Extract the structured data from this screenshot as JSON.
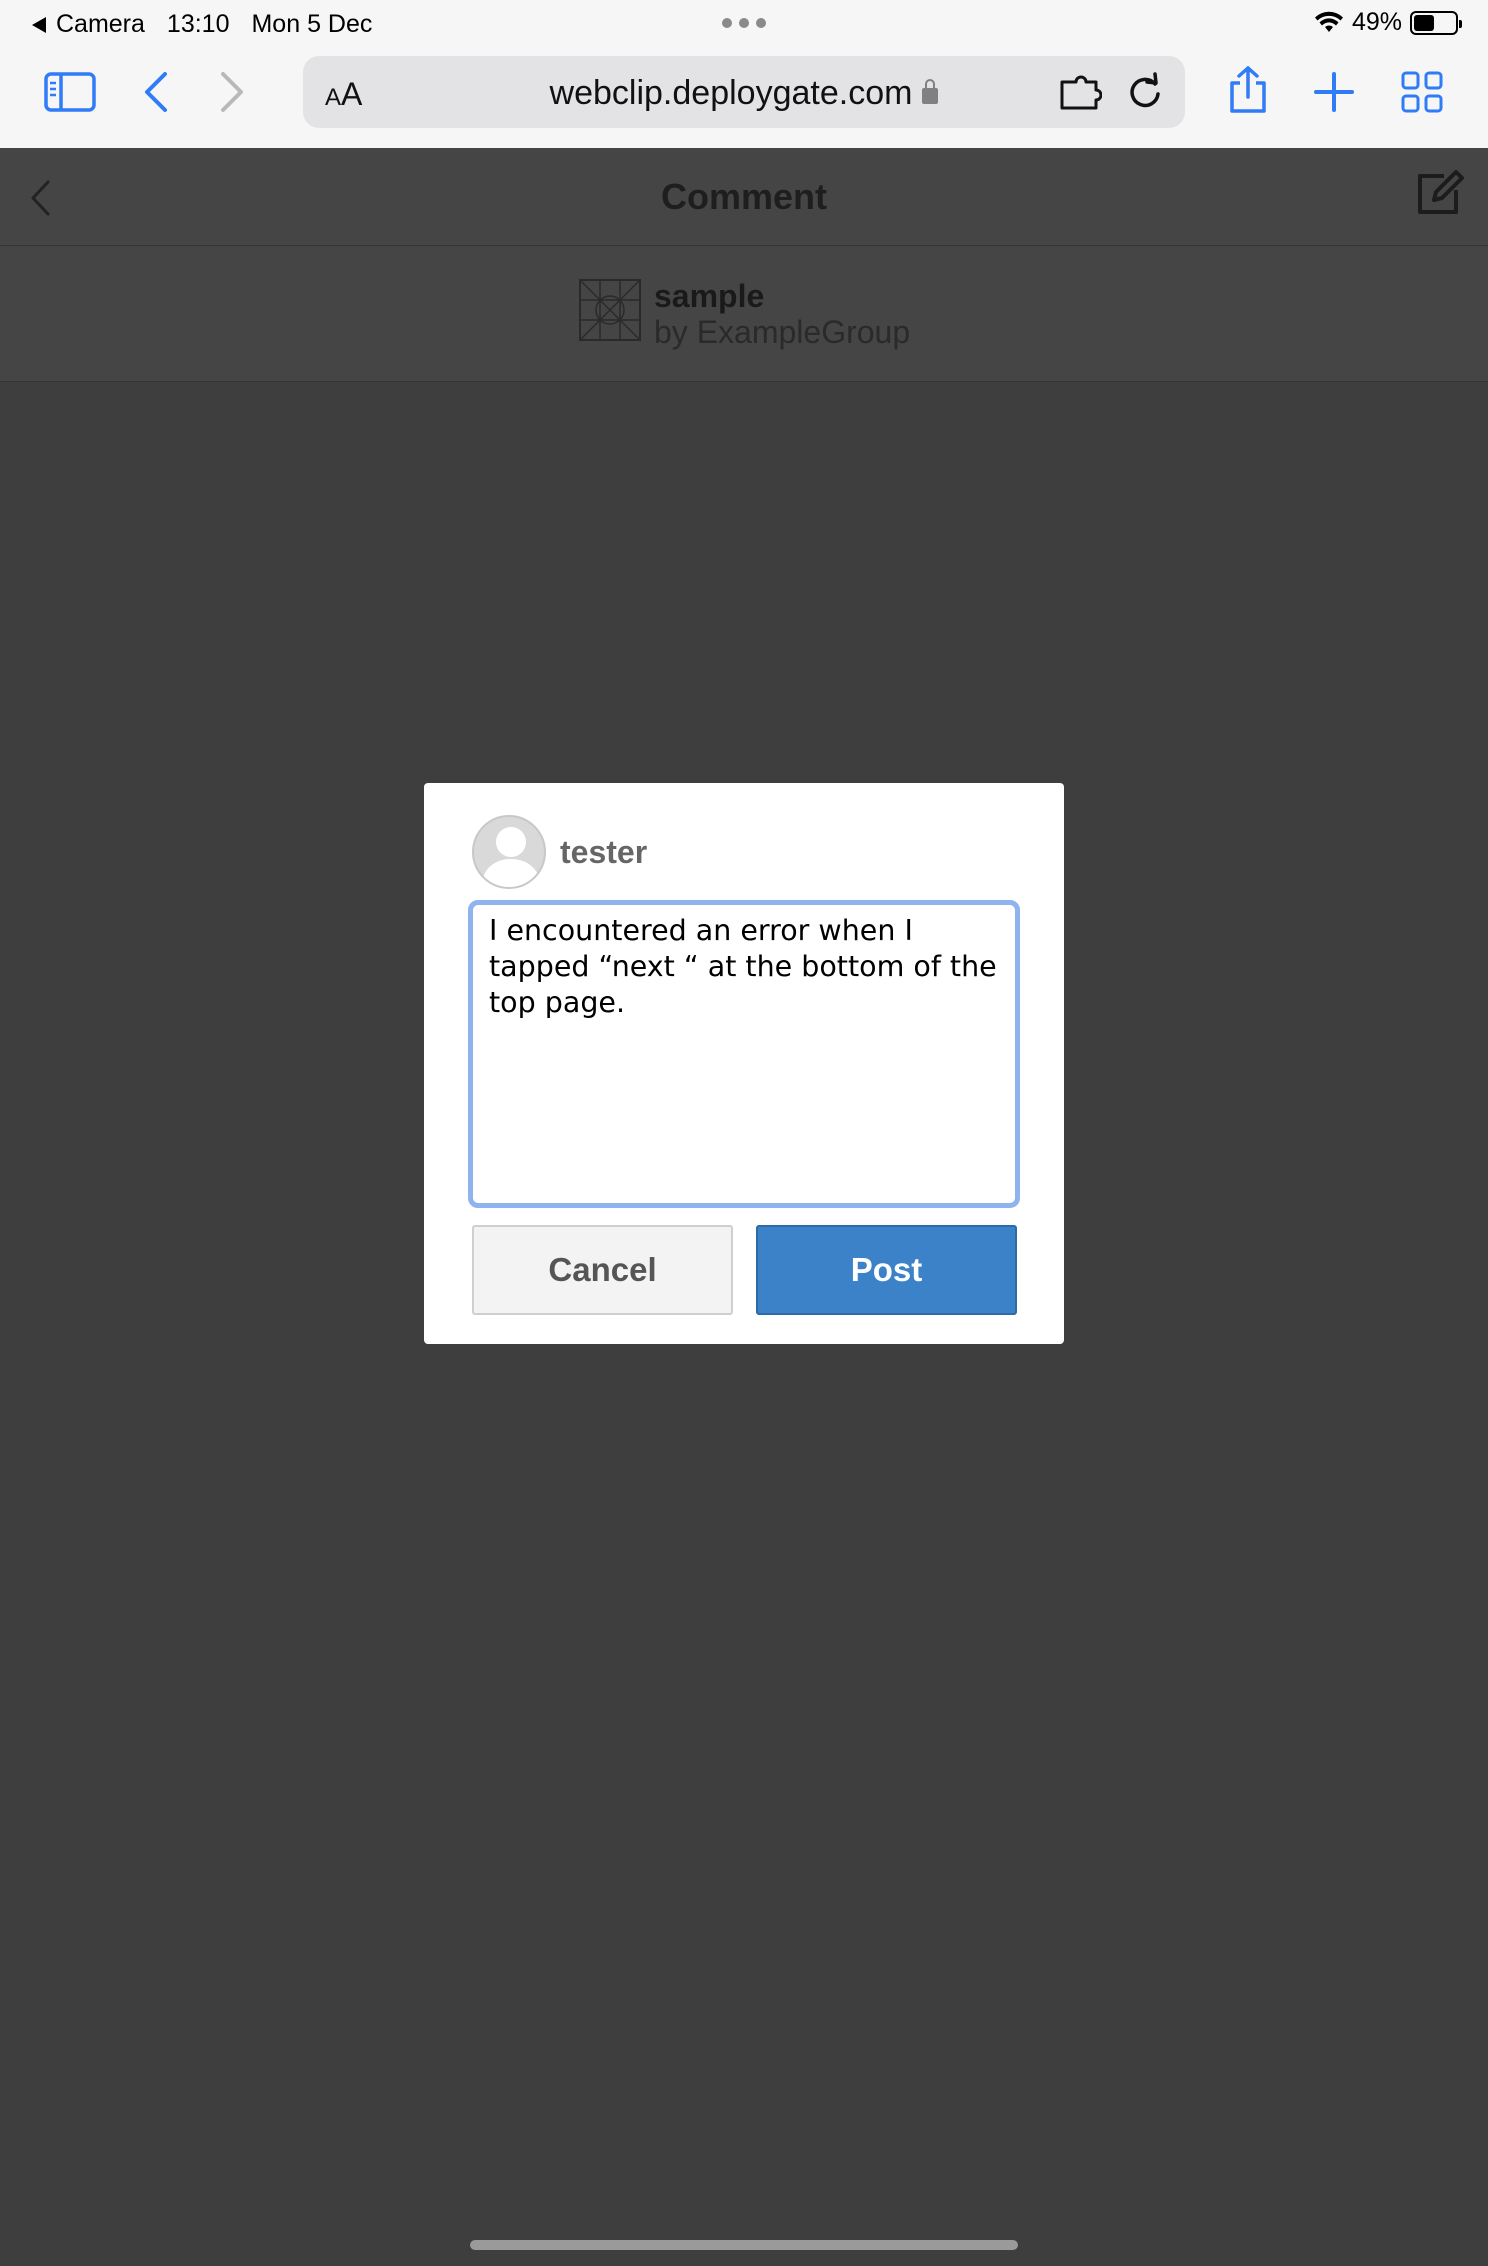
{
  "status_bar": {
    "back_app": "Camera",
    "time": "13:10",
    "date": "Mon 5 Dec",
    "battery": "49%",
    "battery_level": 0.49
  },
  "browser": {
    "text_size_small": "A",
    "text_size_large": "A",
    "url": "webclip.deploygate.com"
  },
  "page_header": {
    "title": "Comment"
  },
  "app_info": {
    "name": "sample",
    "by": "by ExampleGroup"
  },
  "modal": {
    "username": "tester",
    "comment_text": "I encountered an error when I tapped “next “ at the bottom of the top page.",
    "cancel_label": "Cancel",
    "post_label": "Post"
  },
  "colors": {
    "accent": "#3b82c8",
    "browser_icon": "#2f7cf6",
    "overlay": "#3e3e3e"
  }
}
